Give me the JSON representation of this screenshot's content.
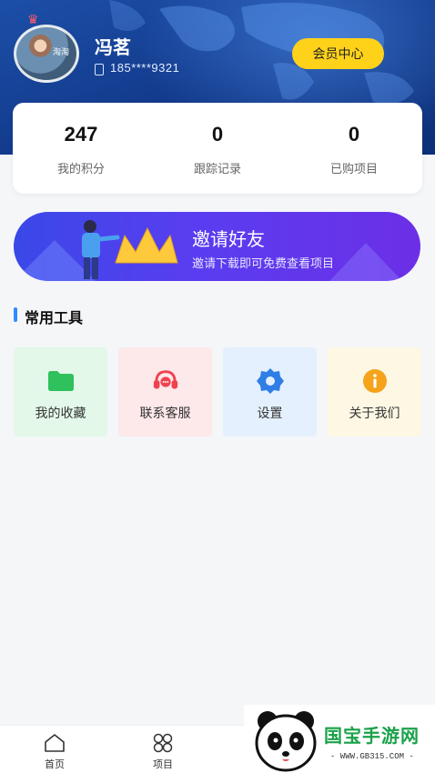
{
  "header": {
    "username": "冯茗",
    "phone": "185****9321",
    "vip_button": "会员中心"
  },
  "stats": [
    {
      "value": "247",
      "label": "我的积分"
    },
    {
      "value": "0",
      "label": "跟踪记录"
    },
    {
      "value": "0",
      "label": "已购项目"
    }
  ],
  "invite": {
    "title": "邀请好友",
    "subtitle": "邀请下载即可免费查看项目"
  },
  "tools_section": {
    "title": "常用工具",
    "items": [
      {
        "label": "我的收藏",
        "icon": "folder-icon",
        "color": "#2ec15c"
      },
      {
        "label": "联系客服",
        "icon": "headset-icon",
        "color": "#f0414f"
      },
      {
        "label": "设置",
        "icon": "gear-icon",
        "color": "#2f7ee6"
      },
      {
        "label": "关于我们",
        "icon": "info-icon",
        "color": "#f4a31a"
      }
    ]
  },
  "tabbar": {
    "items": [
      {
        "label": "首页",
        "icon": "home-icon"
      },
      {
        "label": "项目",
        "icon": "grid-icon"
      }
    ]
  },
  "watermark": {
    "brand": "国宝手游网",
    "url": "- WWW.GB315.COM -"
  }
}
